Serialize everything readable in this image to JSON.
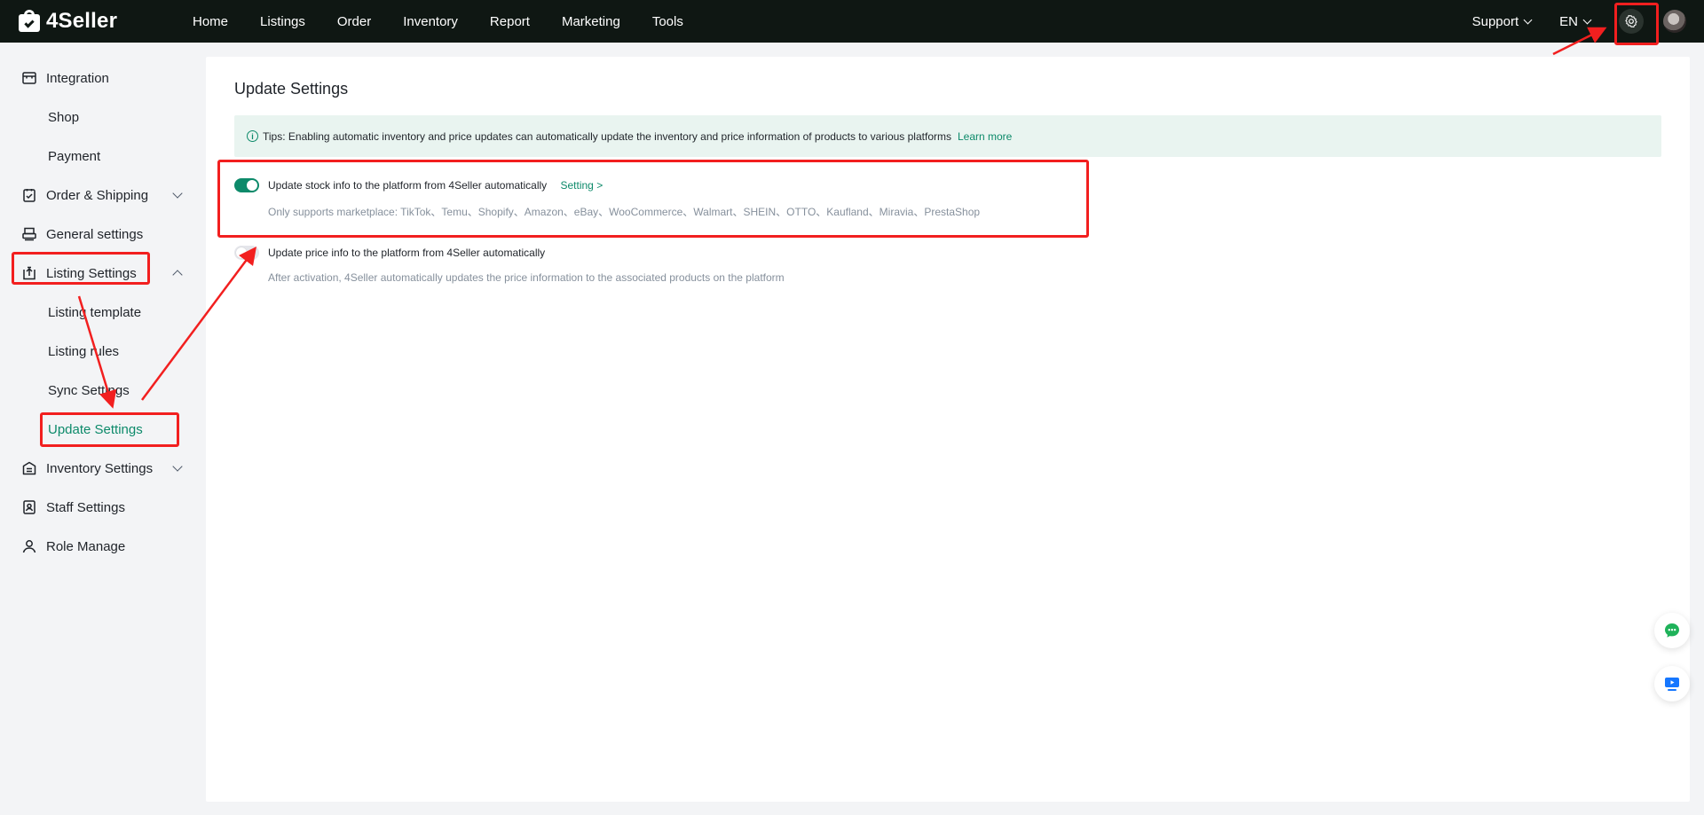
{
  "brand": {
    "name": "4Seller"
  },
  "nav": {
    "items": [
      {
        "label": "Home"
      },
      {
        "label": "Listings"
      },
      {
        "label": "Order"
      },
      {
        "label": "Inventory"
      },
      {
        "label": "Report"
      },
      {
        "label": "Marketing"
      },
      {
        "label": "Tools"
      }
    ],
    "support_label": "Support",
    "language_label": "EN",
    "settings_icon": "gear-icon",
    "avatar_icon": "user-avatar"
  },
  "sidebar": {
    "items": [
      {
        "label": "Integration",
        "icon": "store-icon"
      },
      {
        "label": "Shop"
      },
      {
        "label": "Payment"
      },
      {
        "label": "Order & Shipping",
        "icon": "clipboard-check-icon",
        "expandable": true
      },
      {
        "label": "General settings",
        "icon": "printer-icon"
      },
      {
        "label": "Listing Settings",
        "icon": "upload-box-icon",
        "expanded": true
      },
      {
        "label": "Listing template"
      },
      {
        "label": "Listing rules"
      },
      {
        "label": "Sync Settings"
      },
      {
        "label": "Update Settings",
        "active": true
      },
      {
        "label": "Inventory Settings",
        "icon": "warehouse-icon",
        "expandable": true
      },
      {
        "label": "Staff Settings",
        "icon": "badge-icon"
      },
      {
        "label": "Role Manage",
        "icon": "user-icon"
      }
    ]
  },
  "main": {
    "title": "Update Settings",
    "tips": {
      "text": "Tips: Enabling automatic inventory and price updates can automatically update the inventory and price information of products to various platforms",
      "link": "Learn more"
    },
    "settings": [
      {
        "title": "Update stock info to the platform from 4Seller automatically",
        "link": "Setting >",
        "description": "Only supports marketplace: TikTok、Temu、Shopify、Amazon、eBay、WooCommerce、Walmart、SHEIN、OTTO、Kaufland、Miravia、PrestaShop",
        "enabled": true
      },
      {
        "title": "Update price info to the platform from 4Seller automatically",
        "description": "After activation, 4Seller automatically updates the price information to the associated products on the platform",
        "enabled": false
      }
    ]
  },
  "colors": {
    "topbar": "#0f1713",
    "accent": "#0d8a6a",
    "annotation": "#f21f1f",
    "chat_icon": "#1fb25a",
    "video_icon": "#1677ff"
  },
  "floating": [
    {
      "icon": "chat-support-icon"
    },
    {
      "icon": "video-tutorial-icon"
    }
  ]
}
